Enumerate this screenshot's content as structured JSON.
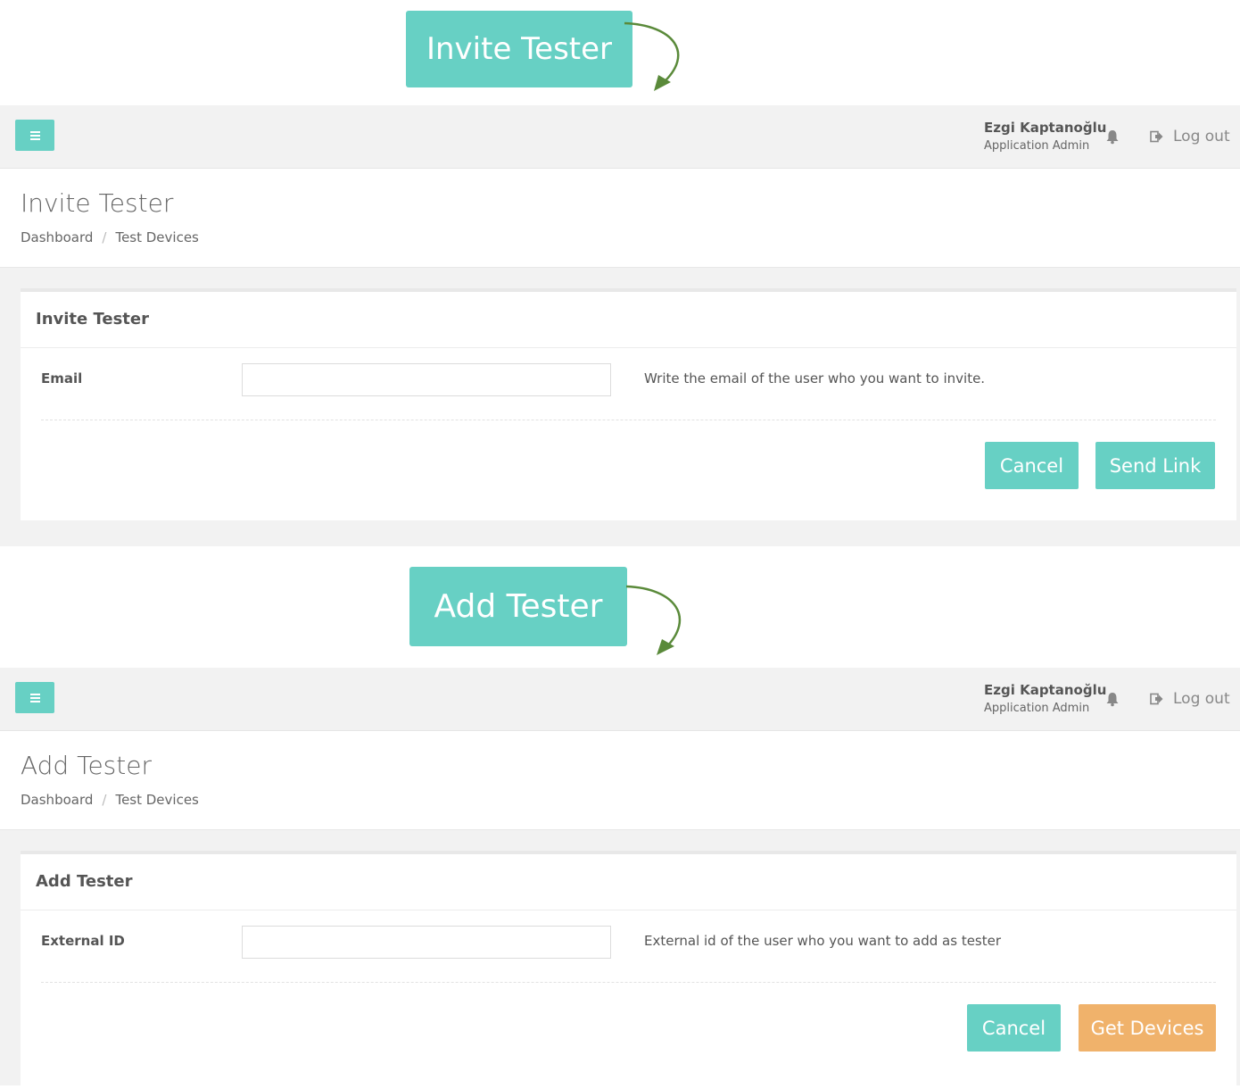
{
  "callouts": {
    "invite": "Invite Tester",
    "add": "Add Tester"
  },
  "topbar": {
    "user_name": "Ezgi Kaptanoğlu",
    "user_role": "Application Admin",
    "logout_label": "Log out"
  },
  "invite_page": {
    "title": "Invite Tester",
    "breadcrumb": [
      "Dashboard",
      "Test Devices"
    ],
    "panel_title": "Invite Tester",
    "field_label": "Email",
    "field_value": "",
    "field_help": "Write the email of the user who you want to invite.",
    "cancel_label": "Cancel",
    "submit_label": "Send Link"
  },
  "add_page": {
    "title": "Add Tester",
    "breadcrumb": [
      "Dashboard",
      "Test Devices"
    ],
    "panel_title": "Add Tester",
    "field_label": "External ID",
    "field_value": "",
    "field_help": "External id of the user who you want to add as tester",
    "cancel_label": "Cancel",
    "submit_label": "Get Devices"
  },
  "colors": {
    "accent": "#67d0c4",
    "warning": "#f0b26b",
    "arrow": "#5a8a3a"
  }
}
